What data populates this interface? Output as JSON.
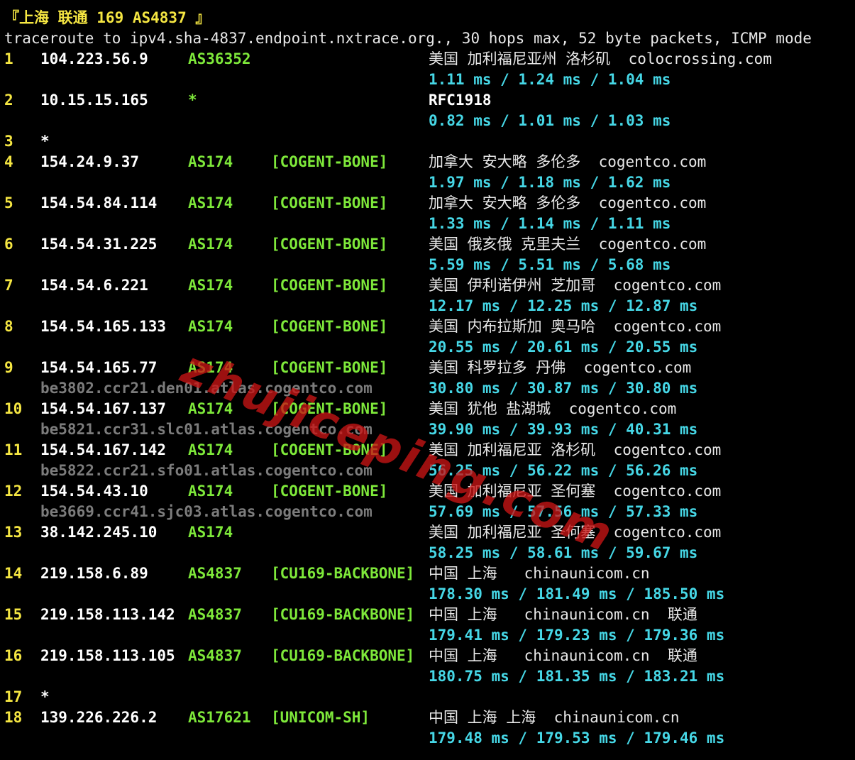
{
  "terminal": {
    "title": "『上海 联通 169 AS4837 』",
    "command": "traceroute to ipv4.sha-4837.endpoint.nxtrace.org., 30 hops max, 52 byte packets, ICMP mode"
  },
  "hops": [
    {
      "n": "1",
      "ip": "104.223.56.9",
      "asn": "AS36352",
      "tag": "",
      "geo": "美国 加利福尼亚州 洛杉矶  colocrossing.com",
      "rtt": "1.11 ms / 1.24 ms / 1.04 ms",
      "host": ""
    },
    {
      "n": "2",
      "ip": "10.15.15.165",
      "asn": "*",
      "tag": "",
      "geo": "RFC1918",
      "rtt": "0.82 ms / 1.01 ms / 1.03 ms",
      "host": ""
    },
    {
      "n": "3",
      "ip": "*",
      "asn": "",
      "tag": "",
      "geo": "",
      "rtt": "",
      "host": ""
    },
    {
      "n": "4",
      "ip": "154.24.9.37",
      "asn": "AS174",
      "tag": "[COGENT-BONE]",
      "geo": "加拿大 安大略 多伦多  cogentco.com",
      "rtt": "1.97 ms / 1.18 ms / 1.62 ms",
      "host": ""
    },
    {
      "n": "5",
      "ip": "154.54.84.114",
      "asn": "AS174",
      "tag": "[COGENT-BONE]",
      "geo": "加拿大 安大略 多伦多  cogentco.com",
      "rtt": "1.33 ms / 1.14 ms / 1.11 ms",
      "host": ""
    },
    {
      "n": "6",
      "ip": "154.54.31.225",
      "asn": "AS174",
      "tag": "[COGENT-BONE]",
      "geo": "美国 俄亥俄 克里夫兰  cogentco.com",
      "rtt": "5.59 ms / 5.51 ms / 5.68 ms",
      "host": ""
    },
    {
      "n": "7",
      "ip": "154.54.6.221",
      "asn": "AS174",
      "tag": "[COGENT-BONE]",
      "geo": "美国 伊利诺伊州 芝加哥  cogentco.com",
      "rtt": "12.17 ms / 12.25 ms / 12.87 ms",
      "host": ""
    },
    {
      "n": "8",
      "ip": "154.54.165.133",
      "asn": "AS174",
      "tag": "[COGENT-BONE]",
      "geo": "美国 内布拉斯加 奥马哈  cogentco.com",
      "rtt": "20.55 ms / 20.61 ms / 20.55 ms",
      "host": ""
    },
    {
      "n": "9",
      "ip": "154.54.165.77",
      "asn": "AS174",
      "tag": "[COGENT-BONE]",
      "geo": "美国 科罗拉多 丹佛  cogentco.com",
      "rtt": "30.80 ms / 30.87 ms / 30.80 ms",
      "host": "be3802.ccr21.den01.atlas.cogentco.com"
    },
    {
      "n": "10",
      "ip": "154.54.167.137",
      "asn": "AS174",
      "tag": "[COGENT-BONE]",
      "geo": "美国 犹他 盐湖城  cogentco.com",
      "rtt": "39.90 ms / 39.93 ms / 40.31 ms",
      "host": "be5821.ccr31.slc01.atlas.cogentco.com"
    },
    {
      "n": "11",
      "ip": "154.54.167.142",
      "asn": "AS174",
      "tag": "[COGENT-BONE]",
      "geo": "美国 加利福尼亚 洛杉矶  cogentco.com",
      "rtt": "56.25 ms / 56.22 ms / 56.26 ms",
      "host": "be5822.ccr21.sfo01.atlas.cogentco.com"
    },
    {
      "n": "12",
      "ip": "154.54.43.10",
      "asn": "AS174",
      "tag": "[COGENT-BONE]",
      "geo": "美国 加利福尼亚 圣何塞  cogentco.com",
      "rtt": "57.69 ms / 57.56 ms / 57.33 ms",
      "host": "be3669.ccr41.sjc03.atlas.cogentco.com"
    },
    {
      "n": "13",
      "ip": "38.142.245.10",
      "asn": "AS174",
      "tag": "",
      "geo": "美国 加利福尼亚 圣何塞  cogentco.com",
      "rtt": "58.25 ms / 58.61 ms / 59.67 ms",
      "host": ""
    },
    {
      "n": "14",
      "ip": "219.158.6.89",
      "asn": "AS4837",
      "tag": "[CU169-BACKBONE]",
      "geo": "中国 上海   chinaunicom.cn",
      "rtt": "178.30 ms / 181.49 ms / 185.50 ms",
      "host": ""
    },
    {
      "n": "15",
      "ip": "219.158.113.142",
      "asn": "AS4837",
      "tag": "[CU169-BACKBONE]",
      "geo": "中国 上海   chinaunicom.cn  联通",
      "rtt": "179.41 ms / 179.23 ms / 179.36 ms",
      "host": ""
    },
    {
      "n": "16",
      "ip": "219.158.113.105",
      "asn": "AS4837",
      "tag": "[CU169-BACKBONE]",
      "geo": "中国 上海   chinaunicom.cn  联通",
      "rtt": "180.75 ms / 181.35 ms / 183.21 ms",
      "host": ""
    },
    {
      "n": "17",
      "ip": "*",
      "asn": "",
      "tag": "",
      "geo": "",
      "rtt": "",
      "host": ""
    },
    {
      "n": "18",
      "ip": "139.226.226.2",
      "asn": "AS17621",
      "tag": "[UNICOM-SH]",
      "geo": "中国 上海 上海  chinaunicom.cn",
      "rtt": "179.48 ms / 179.53 ms / 179.46 ms",
      "host": ""
    }
  ],
  "watermark": "zhujiceping.com",
  "colors": {
    "background": "#000000",
    "hop_number": "#f5e642",
    "asn": "#7ee83a",
    "rtt": "#46d7e6",
    "hostname": "#7c7c7c",
    "watermark": "#c81414"
  }
}
